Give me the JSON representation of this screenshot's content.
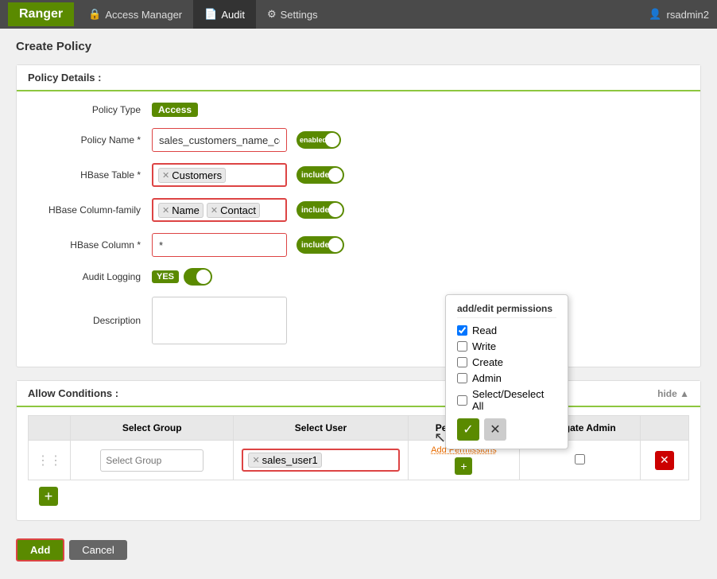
{
  "navbar": {
    "brand": "Ranger",
    "items": [
      {
        "label": "Access Manager",
        "icon": "🔒",
        "active": false
      },
      {
        "label": "Audit",
        "icon": "📄",
        "active": false
      },
      {
        "label": "Settings",
        "icon": "⚙",
        "active": false
      }
    ],
    "user": "rsadmin2",
    "user_icon": "👤"
  },
  "page": {
    "title": "Create Policy"
  },
  "policy_details": {
    "section_label": "Policy Details :",
    "policy_type": {
      "label": "Policy Type",
      "value": "Access"
    },
    "policy_name": {
      "label": "Policy Name *",
      "value": "sales_customers_name_contact",
      "toggle_state": "enabled"
    },
    "hbase_table": {
      "label": "HBase Table *",
      "tags": [
        "Customers"
      ],
      "toggle_label": "include",
      "toggle_on": true
    },
    "hbase_column_family": {
      "label": "HBase Column-family",
      "tags": [
        "Name",
        "Contact"
      ],
      "toggle_label": "include",
      "toggle_on": true
    },
    "hbase_column": {
      "label": "HBase Column *",
      "value": "*",
      "toggle_label": "include",
      "toggle_on": true
    },
    "audit_logging": {
      "label": "Audit Logging",
      "yes_label": "YES",
      "toggle_on": true
    },
    "description": {
      "label": "Description",
      "placeholder": ""
    }
  },
  "allow_conditions": {
    "section_label": "Allow Conditions :",
    "hide_label": "hide ▲",
    "table": {
      "columns": [
        "Select Group",
        "Select User",
        "Permissions",
        "Delegate Admin",
        ""
      ],
      "rows": [
        {
          "select_group_placeholder": "Select Group",
          "select_user_tags": [
            "sales_user1"
          ],
          "permissions_label": "Add Permissions",
          "delegate_admin": false
        }
      ]
    },
    "add_row_btn": "+"
  },
  "popup": {
    "title": "add/edit permissions",
    "checkboxes": [
      {
        "label": "Read",
        "checked": true
      },
      {
        "label": "Write",
        "checked": false
      },
      {
        "label": "Create",
        "checked": false
      },
      {
        "label": "Admin",
        "checked": false
      },
      {
        "label": "Select/Deselect All",
        "checked": false
      }
    ],
    "ok_icon": "✓",
    "cancel_icon": "✕"
  },
  "footer": {
    "add_label": "Add",
    "cancel_label": "Cancel"
  }
}
